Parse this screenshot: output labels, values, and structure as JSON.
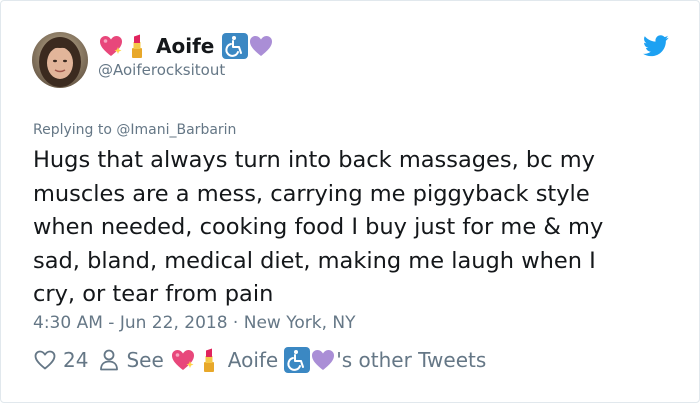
{
  "author": {
    "display_name": "Aoife",
    "handle": "@Aoiferocksitout",
    "name_emoji_icons": [
      "sparkling-heart-icon",
      "lipstick-icon",
      "wheelchair-symbol-icon",
      "purple-heart-icon"
    ]
  },
  "reply": {
    "prefix": "Replying to",
    "to_handle": "@Imani_Barbarin"
  },
  "tweet": {
    "lines": [
      "Hugs that always turn into back massages, bc my",
      "muscles are a mess, carrying me piggyback style",
      "when needed, cooking food I buy just for me & my",
      "sad, bland, medical diet, making me laugh when I",
      "cry, or tear from pain"
    ],
    "time": "4:30 AM",
    "date": "Jun 22, 2018",
    "location": "New York, NY"
  },
  "actions": {
    "like_count": "24",
    "see_label": "See",
    "other_tweets_suffix": "'s other Tweets"
  },
  "colors": {
    "text": "#14171a",
    "secondary": "#657786",
    "twitter_blue": "#1da1f2",
    "border": "#e1e8ed"
  }
}
